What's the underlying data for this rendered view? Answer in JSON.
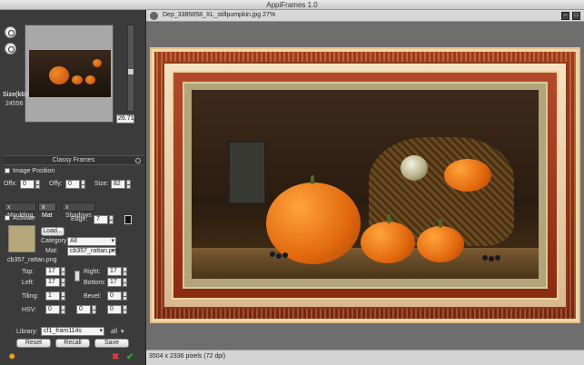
{
  "app": {
    "title": "AppiFrames 1.0"
  },
  "preview": {
    "size_label": "Size(kb):",
    "size_value": "24556",
    "zoom_value": "26.71"
  },
  "panel": {
    "section_title": "Classy Frames",
    "image_position": {
      "label": "Image Position",
      "offx_label": "Offx:",
      "offx_value": "0",
      "offy_label": "Offy:",
      "offy_value": "0",
      "size_label": "Size:",
      "size_value": "82"
    },
    "tabs": [
      {
        "label": "x Moulding"
      },
      {
        "label": "x Mat"
      },
      {
        "label": "x Shadows"
      }
    ],
    "mat": {
      "activate_label": "Activate",
      "edge_label": "Edge:",
      "edge_value": "7",
      "load_label": "Load...",
      "category_label": "Category:",
      "category_value": "All",
      "mat_label": "Mat:",
      "mat_value": "cb357_rattan.png",
      "filename": "cb357_rattan.png",
      "top_label": "Top:",
      "top_value": "17",
      "right_label": "Right:",
      "right_value": "17",
      "left_label": "Left:",
      "left_value": "17",
      "bottom_label": "Bottom:",
      "bottom_value": "17",
      "tiling_label": "Tiling:",
      "tiling_value": "1",
      "bevel_label": "Bevel:",
      "bevel_value": "0",
      "hsv_label": "HSV:",
      "hsv_h": "0",
      "hsv_s": "0",
      "hsv_v": "0"
    },
    "library": {
      "label": "Library:",
      "value": "cf1_fram114s",
      "filter": "all"
    },
    "buttons": {
      "reset": "Reset",
      "recall": "Recall",
      "save": "Save"
    }
  },
  "document": {
    "title": "Dep_3385858_XL_stillpumpkin.jpg 27%",
    "status": "3504 x 2336 pixels (72 dpi)"
  },
  "colors": {
    "mat": "#b1a579",
    "frame_red": "#a8401e",
    "panel_bg": "#3b3b3b",
    "accent_orange": "#f5a623",
    "cancel_red": "#e03c3c",
    "ok_green": "#3c9e3c"
  }
}
